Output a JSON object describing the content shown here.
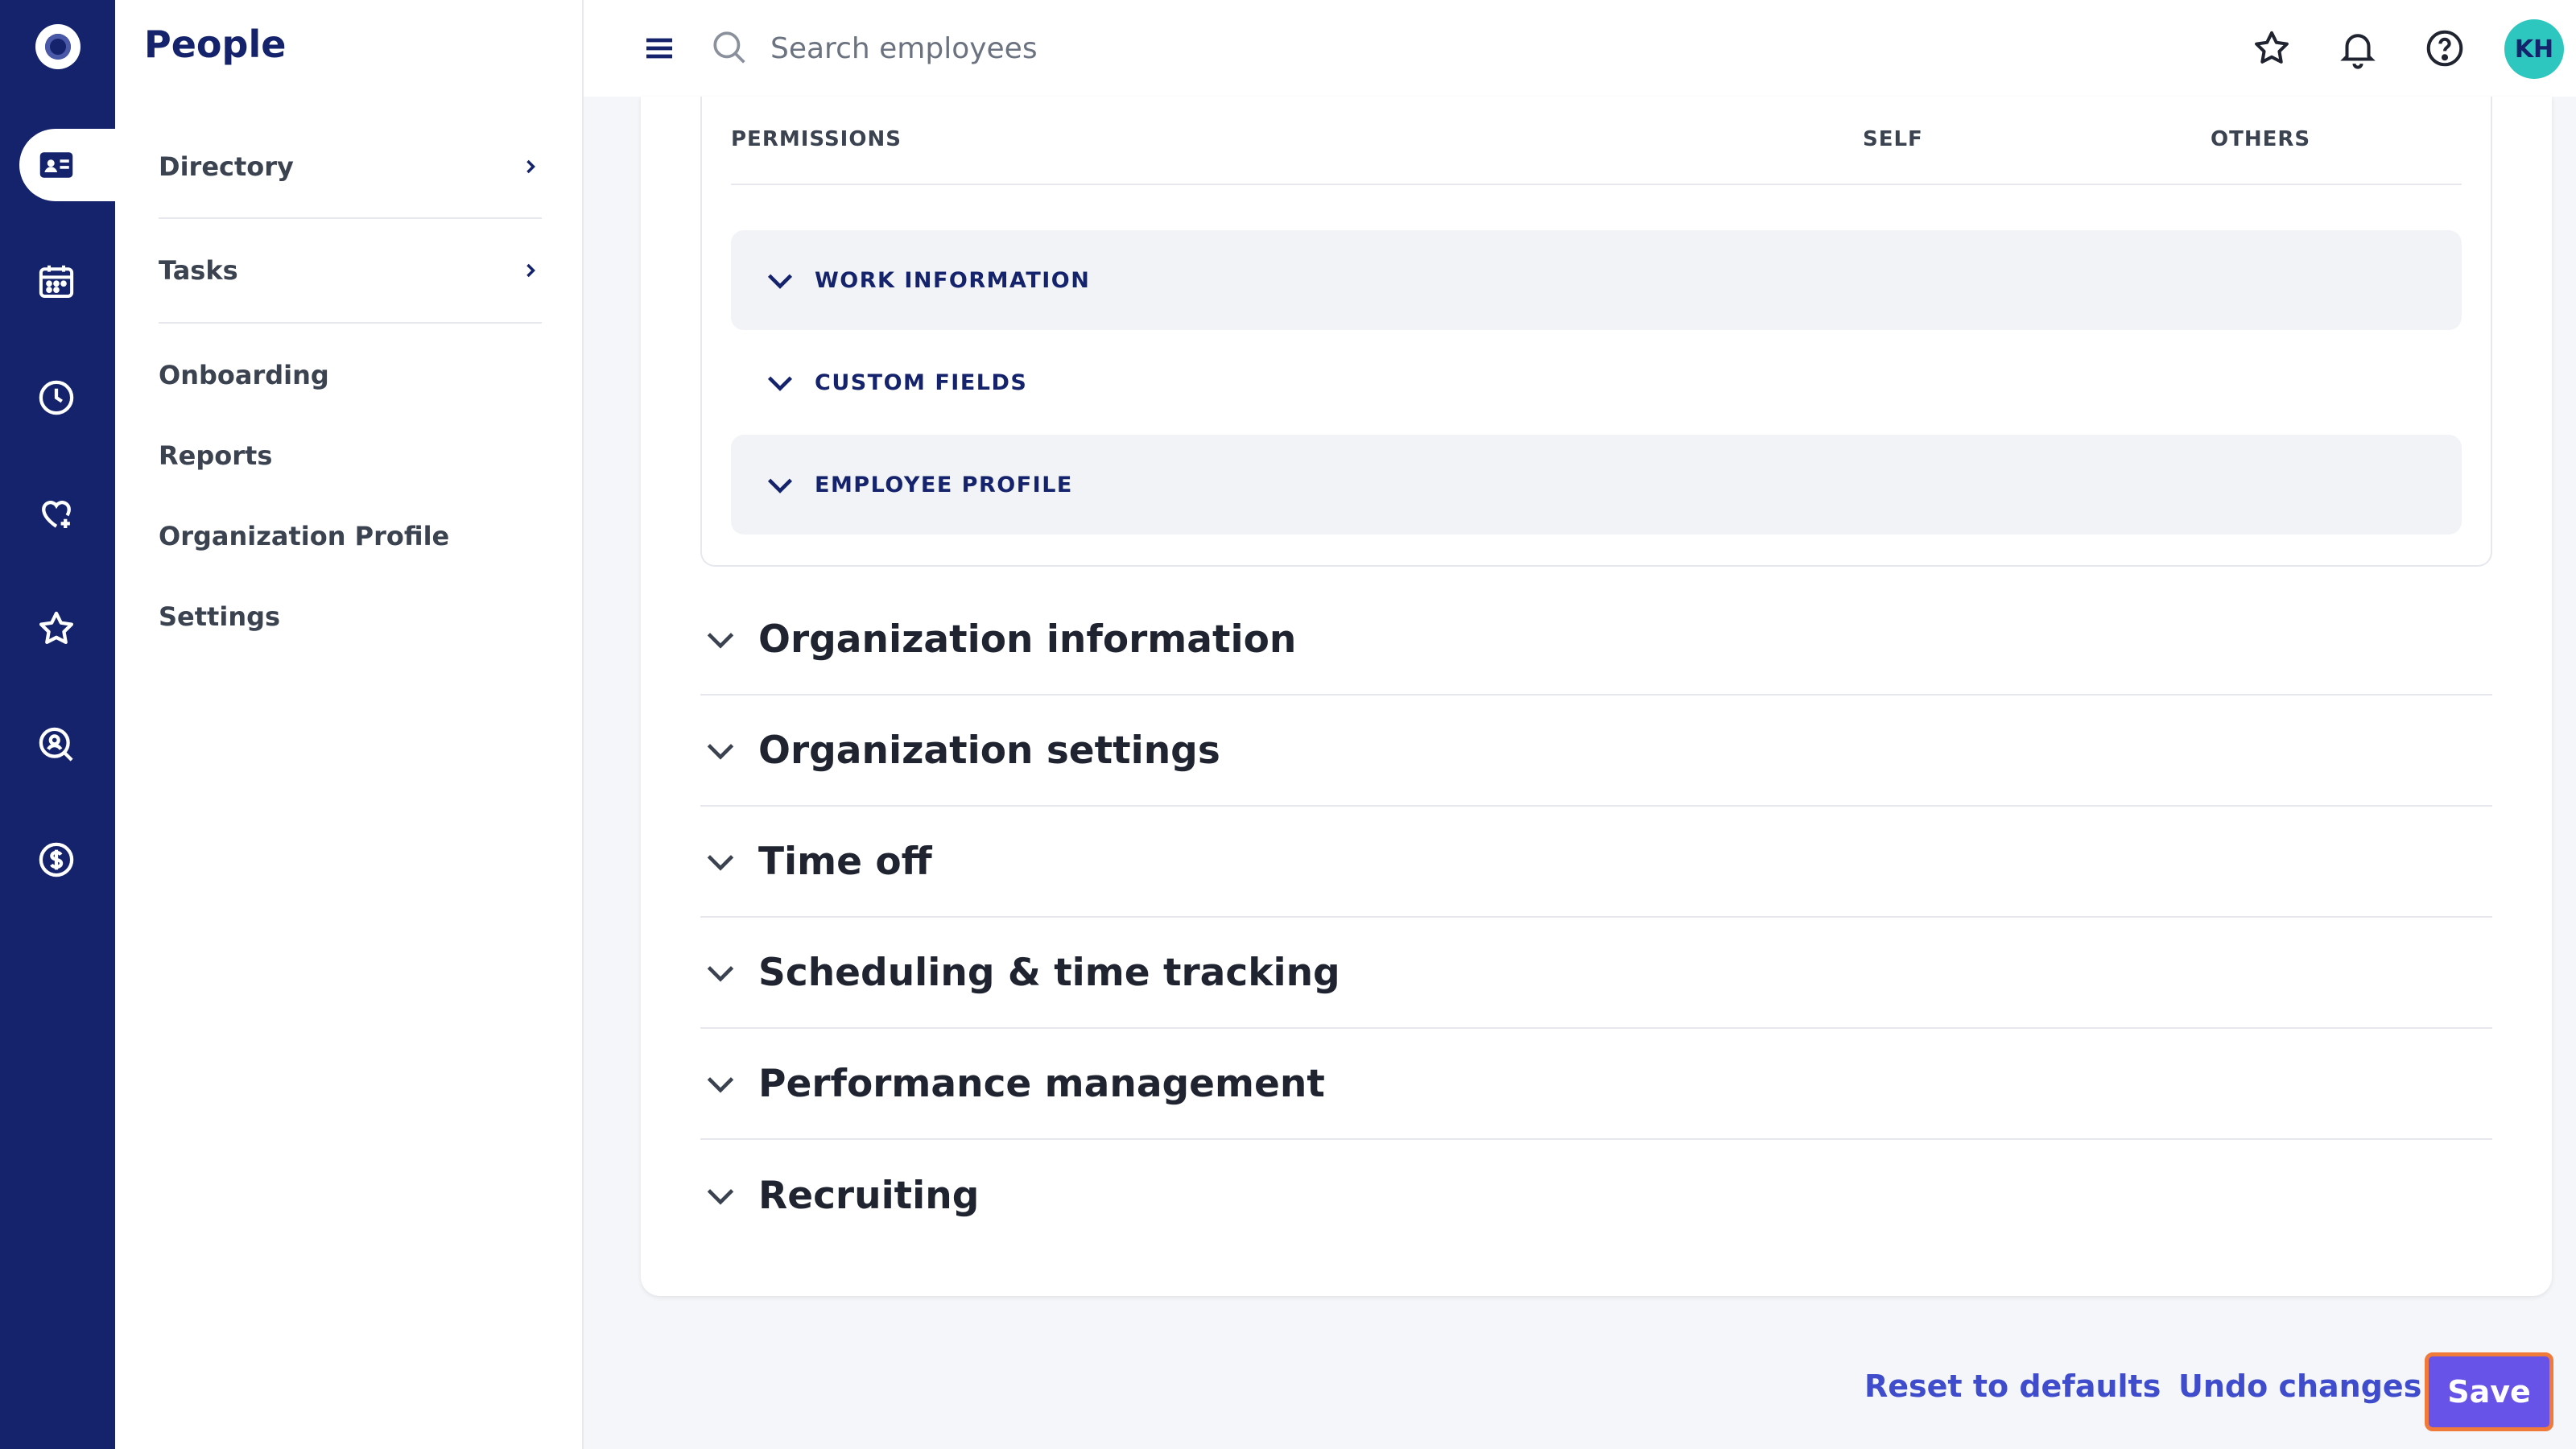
{
  "app": {
    "section_title": "People"
  },
  "rail": {
    "items": [
      {
        "icon": "people-icon",
        "active": true
      },
      {
        "icon": "calendar-icon"
      },
      {
        "icon": "clock-icon"
      },
      {
        "icon": "heart-icon"
      },
      {
        "icon": "star-icon"
      },
      {
        "icon": "search-person-icon"
      },
      {
        "icon": "dollar-icon"
      }
    ]
  },
  "subnav": {
    "items": [
      {
        "label": "Directory",
        "has_chevron": true
      },
      {
        "label": "Tasks",
        "has_chevron": true
      },
      {
        "label": "Onboarding"
      },
      {
        "label": "Reports"
      },
      {
        "label": "Organization Profile"
      },
      {
        "label": "Settings"
      }
    ]
  },
  "topbar": {
    "search_placeholder": "Search employees",
    "avatar_initials": "KH"
  },
  "permissions": {
    "headers": {
      "permissions": "PERMISSIONS",
      "self": "SELF",
      "others": "OTHERS"
    },
    "groups": [
      "WORK INFORMATION",
      "CUSTOM FIELDS",
      "EMPLOYEE PROFILE"
    ]
  },
  "sections": [
    "Organization information",
    "Organization settings",
    "Time off",
    "Scheduling & time tracking",
    "Performance management",
    "Recruiting"
  ],
  "footer": {
    "reset_label": "Reset to defaults",
    "undo_label": "Undo changes",
    "save_label": "Save"
  },
  "colors": {
    "rail_bg": "#14236b",
    "accent": "#3f4ccc",
    "save_bg": "#6753e8",
    "save_border": "#f07a3a",
    "avatar_bg": "#2dc7c0"
  }
}
